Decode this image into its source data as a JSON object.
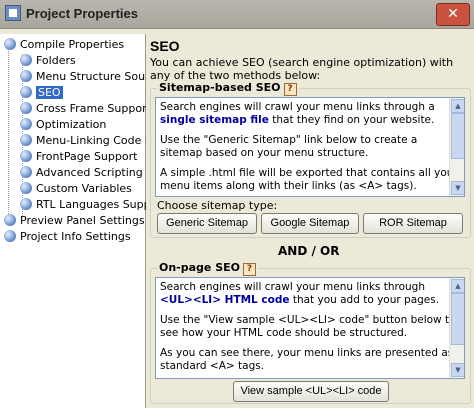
{
  "window": {
    "title": "Project Properties",
    "close_glyph": "✕"
  },
  "tree": {
    "compile": "Compile Properties",
    "folders": "Folders",
    "menu_structure": "Menu Structure Sourc",
    "seo": "SEO",
    "cross_frame": "Cross Frame Support",
    "optimization": "Optimization",
    "menu_linking": "Menu-Linking Code in",
    "frontpage": "FrontPage Support",
    "advanced_scripting": "Advanced Scripting",
    "custom_vars": "Custom Variables",
    "rtl": "RTL Languages Supp",
    "preview_panel": "Preview Panel Settings",
    "project_info": "Project Info Settings"
  },
  "seo": {
    "heading": "SEO",
    "intro": "You can achieve SEO (search engine optimization) with any of the two methods below:",
    "sitemap": {
      "title": "Sitemap-based SEO",
      "help": "?",
      "p1_a": "Search engines will crawl your menu links through a ",
      "p1_b": "single sitemap file",
      "p1_c": " that they find on your website.",
      "p2": "Use the \"Generic Sitemap\" link below to create a sitemap based on your menu structure.",
      "p3": "A simple .html file will be exported that contains all your menu items along with their links (as <A> tags).",
      "choose_label": "Choose sitemap type:",
      "btn_generic": "Generic Sitemap",
      "btn_google": "Google Sitemap",
      "btn_ror": "ROR Sitemap"
    },
    "andor": "AND / OR",
    "onpage": {
      "title": "On-page SEO",
      "help": "?",
      "p1_a": "Search engines will crawl your menu links through ",
      "p1_b": "<UL><LI> HTML code",
      "p1_c": " that you add to your pages.",
      "p2": "Use the \"View sample <UL><LI> code\" button below to see how your HTML code should be structured.",
      "p3": "As you can see there, your menu links are presented as standard <A> tags.",
      "btn_view": "View sample <UL><LI> code"
    }
  }
}
